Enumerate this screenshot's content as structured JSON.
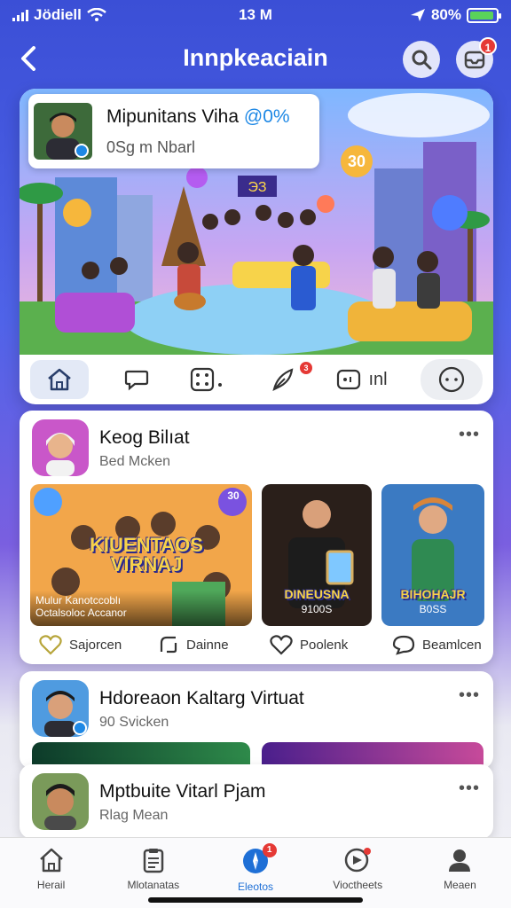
{
  "status_bar": {
    "carrier": "Jödiell",
    "time": "13 M",
    "battery": "80%",
    "battery_level": 0.8
  },
  "header": {
    "title": "Innpkeaciain",
    "notification_count": "1"
  },
  "hero": {
    "title": "Mipunitans Viha",
    "title_accent": "@0%",
    "subtitle": "0Sg m Nbarl",
    "scene_sign": "30",
    "board": "ЭЗ",
    "comment_badge": "3",
    "action_text": "ınl"
  },
  "post1": {
    "title": "Keog Bilıat",
    "subtitle": "Bed Mcken",
    "thumbs": [
      {
        "big": "KIUENTAOS VIRNAJ",
        "caption1": "Mulur Kanotccoblı",
        "caption2": "Octalsoloc Accanor",
        "sign": "30"
      },
      {
        "big": "DINEUSNA",
        "caption1": "9100S"
      },
      {
        "big": "BIHOHAJR",
        "caption1": "B0SS"
      }
    ],
    "actions": [
      "Sajorcen",
      "Dainne",
      "Poolenk",
      "Beamlcen"
    ]
  },
  "post2": {
    "title": "Hdoreaon Kaltarg Virtuat",
    "subtitle": "90 Svicken"
  },
  "post3": {
    "title": "Mptbuite Vitarl Pjam",
    "subtitle": "Rlag Mean"
  },
  "bottom_nav": {
    "items": [
      {
        "label": "Herail",
        "icon": "home-icon"
      },
      {
        "label": "Mlotanatas",
        "icon": "clipboard-icon"
      },
      {
        "label": "Eleotos",
        "icon": "compass-icon",
        "badge": "1"
      },
      {
        "label": "Vioctheets",
        "icon": "video-chat-icon"
      },
      {
        "label": "Meaen",
        "icon": "profile-icon"
      }
    ]
  },
  "colors": {
    "accent": "#1e88e5",
    "badge": "#e53935",
    "header_bg": "#3b4fd6"
  }
}
